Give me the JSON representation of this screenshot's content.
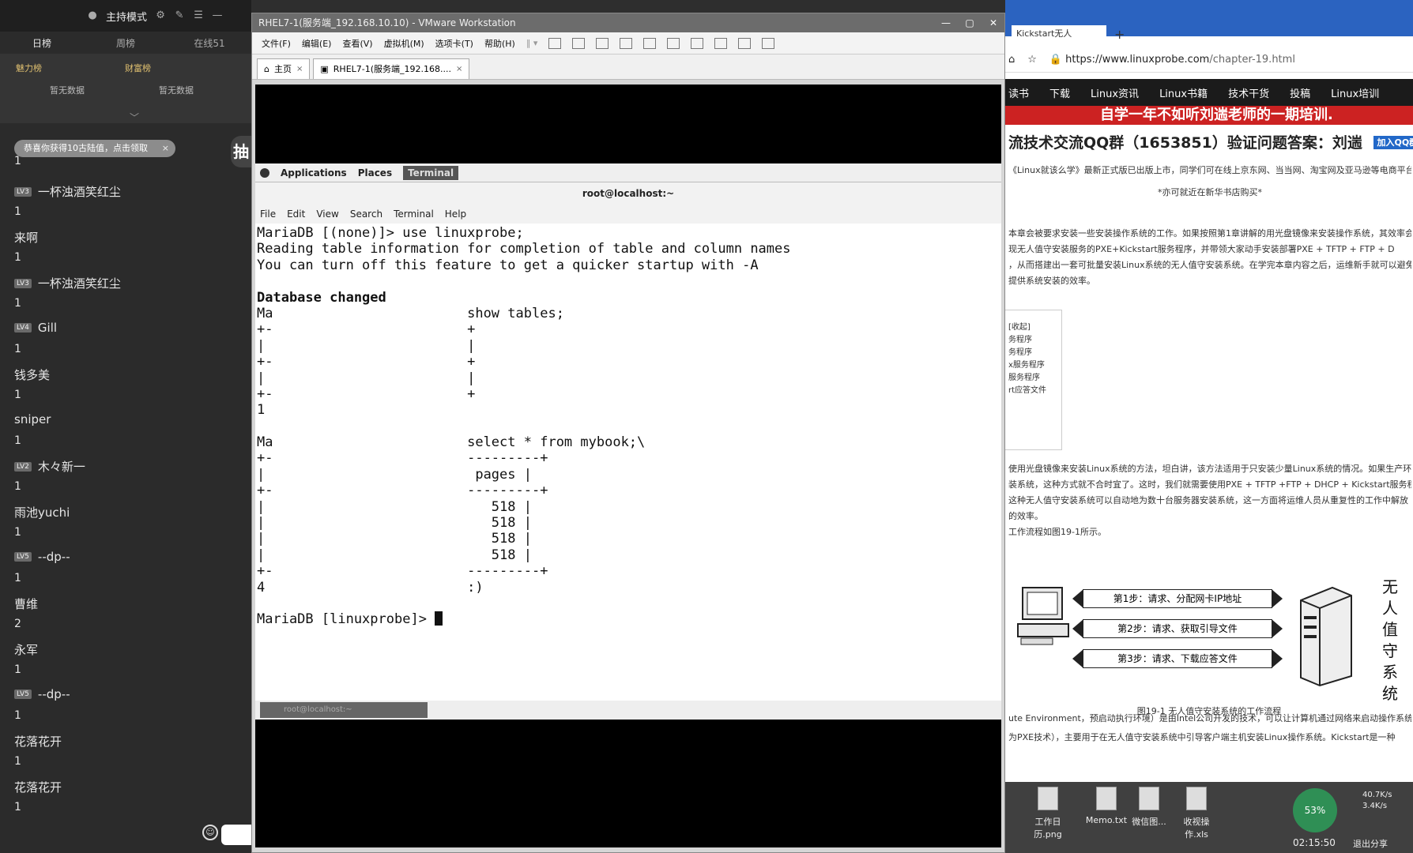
{
  "left_panel": {
    "host_mode": "主持模式",
    "tabs": [
      "日榜",
      "周榜",
      "在线51"
    ],
    "boards": [
      {
        "title": "魅力榜",
        "status": "暂无数据"
      },
      {
        "title": "财富榜",
        "status": "暂无数据"
      }
    ],
    "toast": "恭喜你获得10古陆值，点击领取",
    "toast_close": "×",
    "avatar_text": "抽",
    "first_count": "1",
    "viewers": [
      {
        "level": "LV3",
        "name": "一杯浊酒笑红尘",
        "count": "1"
      },
      {
        "level": "",
        "name": "来啊",
        "count": "1"
      },
      {
        "level": "LV3",
        "name": "一杯浊酒笑红尘",
        "count": "1"
      },
      {
        "level": "LV4",
        "name": "Gill",
        "count": "1"
      },
      {
        "level": "",
        "name": "钱多美",
        "count": "1"
      },
      {
        "level": "",
        "name": "sniper",
        "count": "1"
      },
      {
        "level": "LV2",
        "name": "木々新一",
        "count": "1"
      },
      {
        "level": "",
        "name": "雨池yuchi",
        "count": "1"
      },
      {
        "level": "LV5",
        "name": "--dp--",
        "count": "1"
      },
      {
        "level": "",
        "name": "曹维",
        "count": "2"
      },
      {
        "level": "",
        "name": "永军",
        "count": "1"
      },
      {
        "level": "LV5",
        "name": "--dp--",
        "count": "1"
      },
      {
        "level": "",
        "name": "花落花开",
        "count": "1"
      },
      {
        "level": "",
        "name": "花落花开",
        "count": "1"
      }
    ]
  },
  "vmware": {
    "title": "RHEL7-1(服务端_192.168.10.10) - VMware Workstation",
    "menu": [
      "文件(F)",
      "编辑(E)",
      "查看(V)",
      "虚拟机(M)",
      "选项卡(T)",
      "帮助(H)"
    ],
    "tabs": [
      "主页",
      "RHEL7-1(服务端_192.168...."
    ],
    "gnome": {
      "applications": "Applications",
      "places": "Places",
      "terminal": "Terminal"
    },
    "terminal": {
      "title": "root@localhost:~",
      "menu": [
        "File",
        "Edit",
        "View",
        "Search",
        "Terminal",
        "Help"
      ],
      "lines": [
        "MariaDB [(none)]> use linuxprobe;",
        "Reading table information for completion of table and column names",
        "You can turn off this feature to get a quicker startup with -A",
        "",
        "Database changed",
        "Ma                        show tables;",
        "+-                        +",
        "|                         |",
        "+-                        +",
        "|                         |",
        "+-                        +",
        "1                         ",
        "",
        "Ma                        select * from mybook;\\",
        "+-                        ---------+",
        "|                          pages |",
        "+-                        ---------+",
        "|                            518 |",
        "|                            518 |",
        "|                            518 |",
        "|                            518 |",
        "+-                        ---------+",
        "4                         :)",
        "",
        "MariaDB [linuxprobe]> "
      ],
      "task": "root@localhost:~"
    }
  },
  "browser": {
    "tab_title": "Kickstart无人",
    "url_prefix": "https://www.linuxprobe.com",
    "url_path": "/chapter-19.html",
    "nav": [
      "读书",
      "下载",
      "Linux资讯",
      "Linux书籍",
      "技术干货",
      "投稿",
      "Linux培训"
    ],
    "banner": "自学一年不如听刘遄老师的一期培训.",
    "qq_line": "流技术交流QQ群（1653851）验证问题答案：刘遄",
    "qq_button": "加入QQ群",
    "p1": "《Linux就该么学》最新正式版已出版上市，同学们可在线上京东网、当当网、淘宝网及亚马逊等电商平台购买。",
    "p2": "*亦可就近在新华书店购买*",
    "body": [
      "本章会被要求安装一些安装操作系统的工作。如果按照第1章讲解的用光盘镜像来安装操作系统，其效率会",
      "现无人值守安装服务的PXE+Kickstart服务程序，并带领大家动手安装部署PXE + TFTP + FTP + D",
      "，从而搭建出一套可批量安装Linux系统的无人值守安装系统。在学完本章内容之后，运维新手就可以避免",
      "提供系统安装的效率。"
    ],
    "toc": [
      "[收起]",
      "务程序",
      "务程序",
      "x服务程序",
      "服务程序",
      "rt应答文件"
    ],
    "body2": [
      "使用光盘镜像来安装Linux系统的方法，坦白讲，该方法适用于只安装少量Linux系统的情况。如果生产环",
      "装系统，这种方式就不合时宜了。这时，我们就需要使用PXE + TFTP +FTP + DHCP + Kickstart服务程",
      "这种无人值守安装系统可以自动地为数十台服务器安装系统，这一方面将运维人员从重复性的工作中解放",
      "的效率。",
      "工作流程如图19-1所示。"
    ],
    "steps": [
      "第1步：请求、分配网卡IP地址",
      "第2步：请求、获取引导文件",
      "第3步：请求、下载应答文件"
    ],
    "vertical_label": [
      "无",
      "人",
      "值",
      "守",
      "系",
      "统"
    ],
    "figure_caption": "图19-1  无人值守安装系统的工作流程",
    "body3": [
      "ute Environment，预启动执行环境）是由Intel公司开发的技术，可以让计算机通过网络来启动操作系统",
      "为PXE技术），主要用于在无人值守安装系统中引导客户端主机安装Linux操作系统。Kickstart是一种"
    ],
    "desktop": [
      {
        "label": "工作日历.png"
      },
      {
        "label": "Memo.txt"
      },
      {
        "label": "微信图..."
      },
      {
        "label": "收视操作.xls"
      }
    ],
    "speed_pct": "53%",
    "speed": [
      "40.7K/s",
      "3.4K/s"
    ],
    "clock": "02:15:50",
    "exit_share": "退出分享"
  }
}
